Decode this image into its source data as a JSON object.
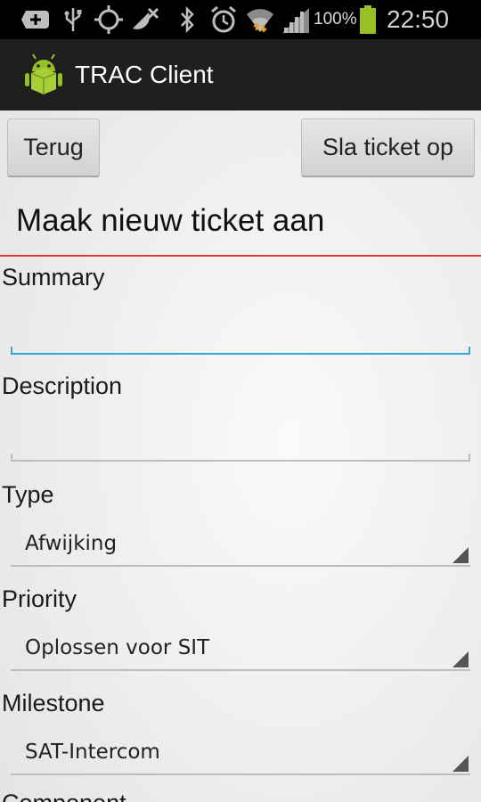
{
  "status_bar": {
    "icons": [
      "notification-plus-icon",
      "usb-icon",
      "gps-icon",
      "no-signal-dish-icon",
      "bluetooth-icon",
      "alarm-icon",
      "wifi-icon",
      "signal-icon",
      "battery-icon"
    ],
    "battery_percent": "100%",
    "time": "22:50"
  },
  "action_bar": {
    "title": "TRAC Client"
  },
  "toolbar": {
    "back_label": "Terug",
    "save_label": "Sla ticket op"
  },
  "page_title": "Maak nieuw ticket aan",
  "form": {
    "summary_label": "Summary",
    "summary_value": "",
    "description_label": "Description",
    "description_value": "",
    "type_label": "Type",
    "type_value": "Afwijking",
    "priority_label": "Priority",
    "priority_value": "Oplossen voor SIT",
    "milestone_label": "Milestone",
    "milestone_value": "SAT-Intercom",
    "component_label": "Component"
  },
  "colors": {
    "divider": "#e53935",
    "focus": "#33a7d8",
    "android_green": "#97c024"
  }
}
